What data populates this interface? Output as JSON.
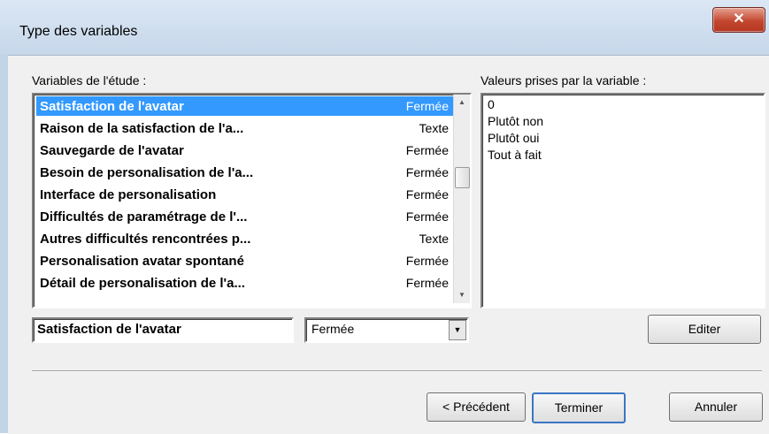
{
  "window": {
    "title": "Type des variables",
    "close_icon": "close-icon"
  },
  "labels": {
    "variables": "Variables de l'étude :",
    "values": "Valeurs prises par la variable :"
  },
  "variables": [
    {
      "name": "Satisfaction de l'avatar",
      "type": "Fermée",
      "selected": true
    },
    {
      "name": "Raison de la satisfaction de l'a...",
      "type": "Texte"
    },
    {
      "name": "Sauvegarde de l'avatar",
      "type": "Fermée"
    },
    {
      "name": "Besoin de personalisation de l'a...",
      "type": "Fermée"
    },
    {
      "name": "Interface de personalisation",
      "type": "Fermée"
    },
    {
      "name": "Difficultés de paramétrage de l'...",
      "type": "Fermée"
    },
    {
      "name": "Autres difficultés rencontrées p...",
      "type": "Texte"
    },
    {
      "name": "Personalisation avatar spontané",
      "type": "Fermée"
    },
    {
      "name": "Détail de personalisation de l'a...",
      "type": "Fermée"
    }
  ],
  "values": [
    "0",
    "Plutôt non",
    "Plutôt oui",
    "Tout à fait"
  ],
  "editor": {
    "name_value": "Satisfaction de l'avatar",
    "type_value": "Fermée"
  },
  "buttons": {
    "edit": "Editer",
    "previous": "< Précédent",
    "finish": "Terminer",
    "cancel": "Annuler"
  }
}
